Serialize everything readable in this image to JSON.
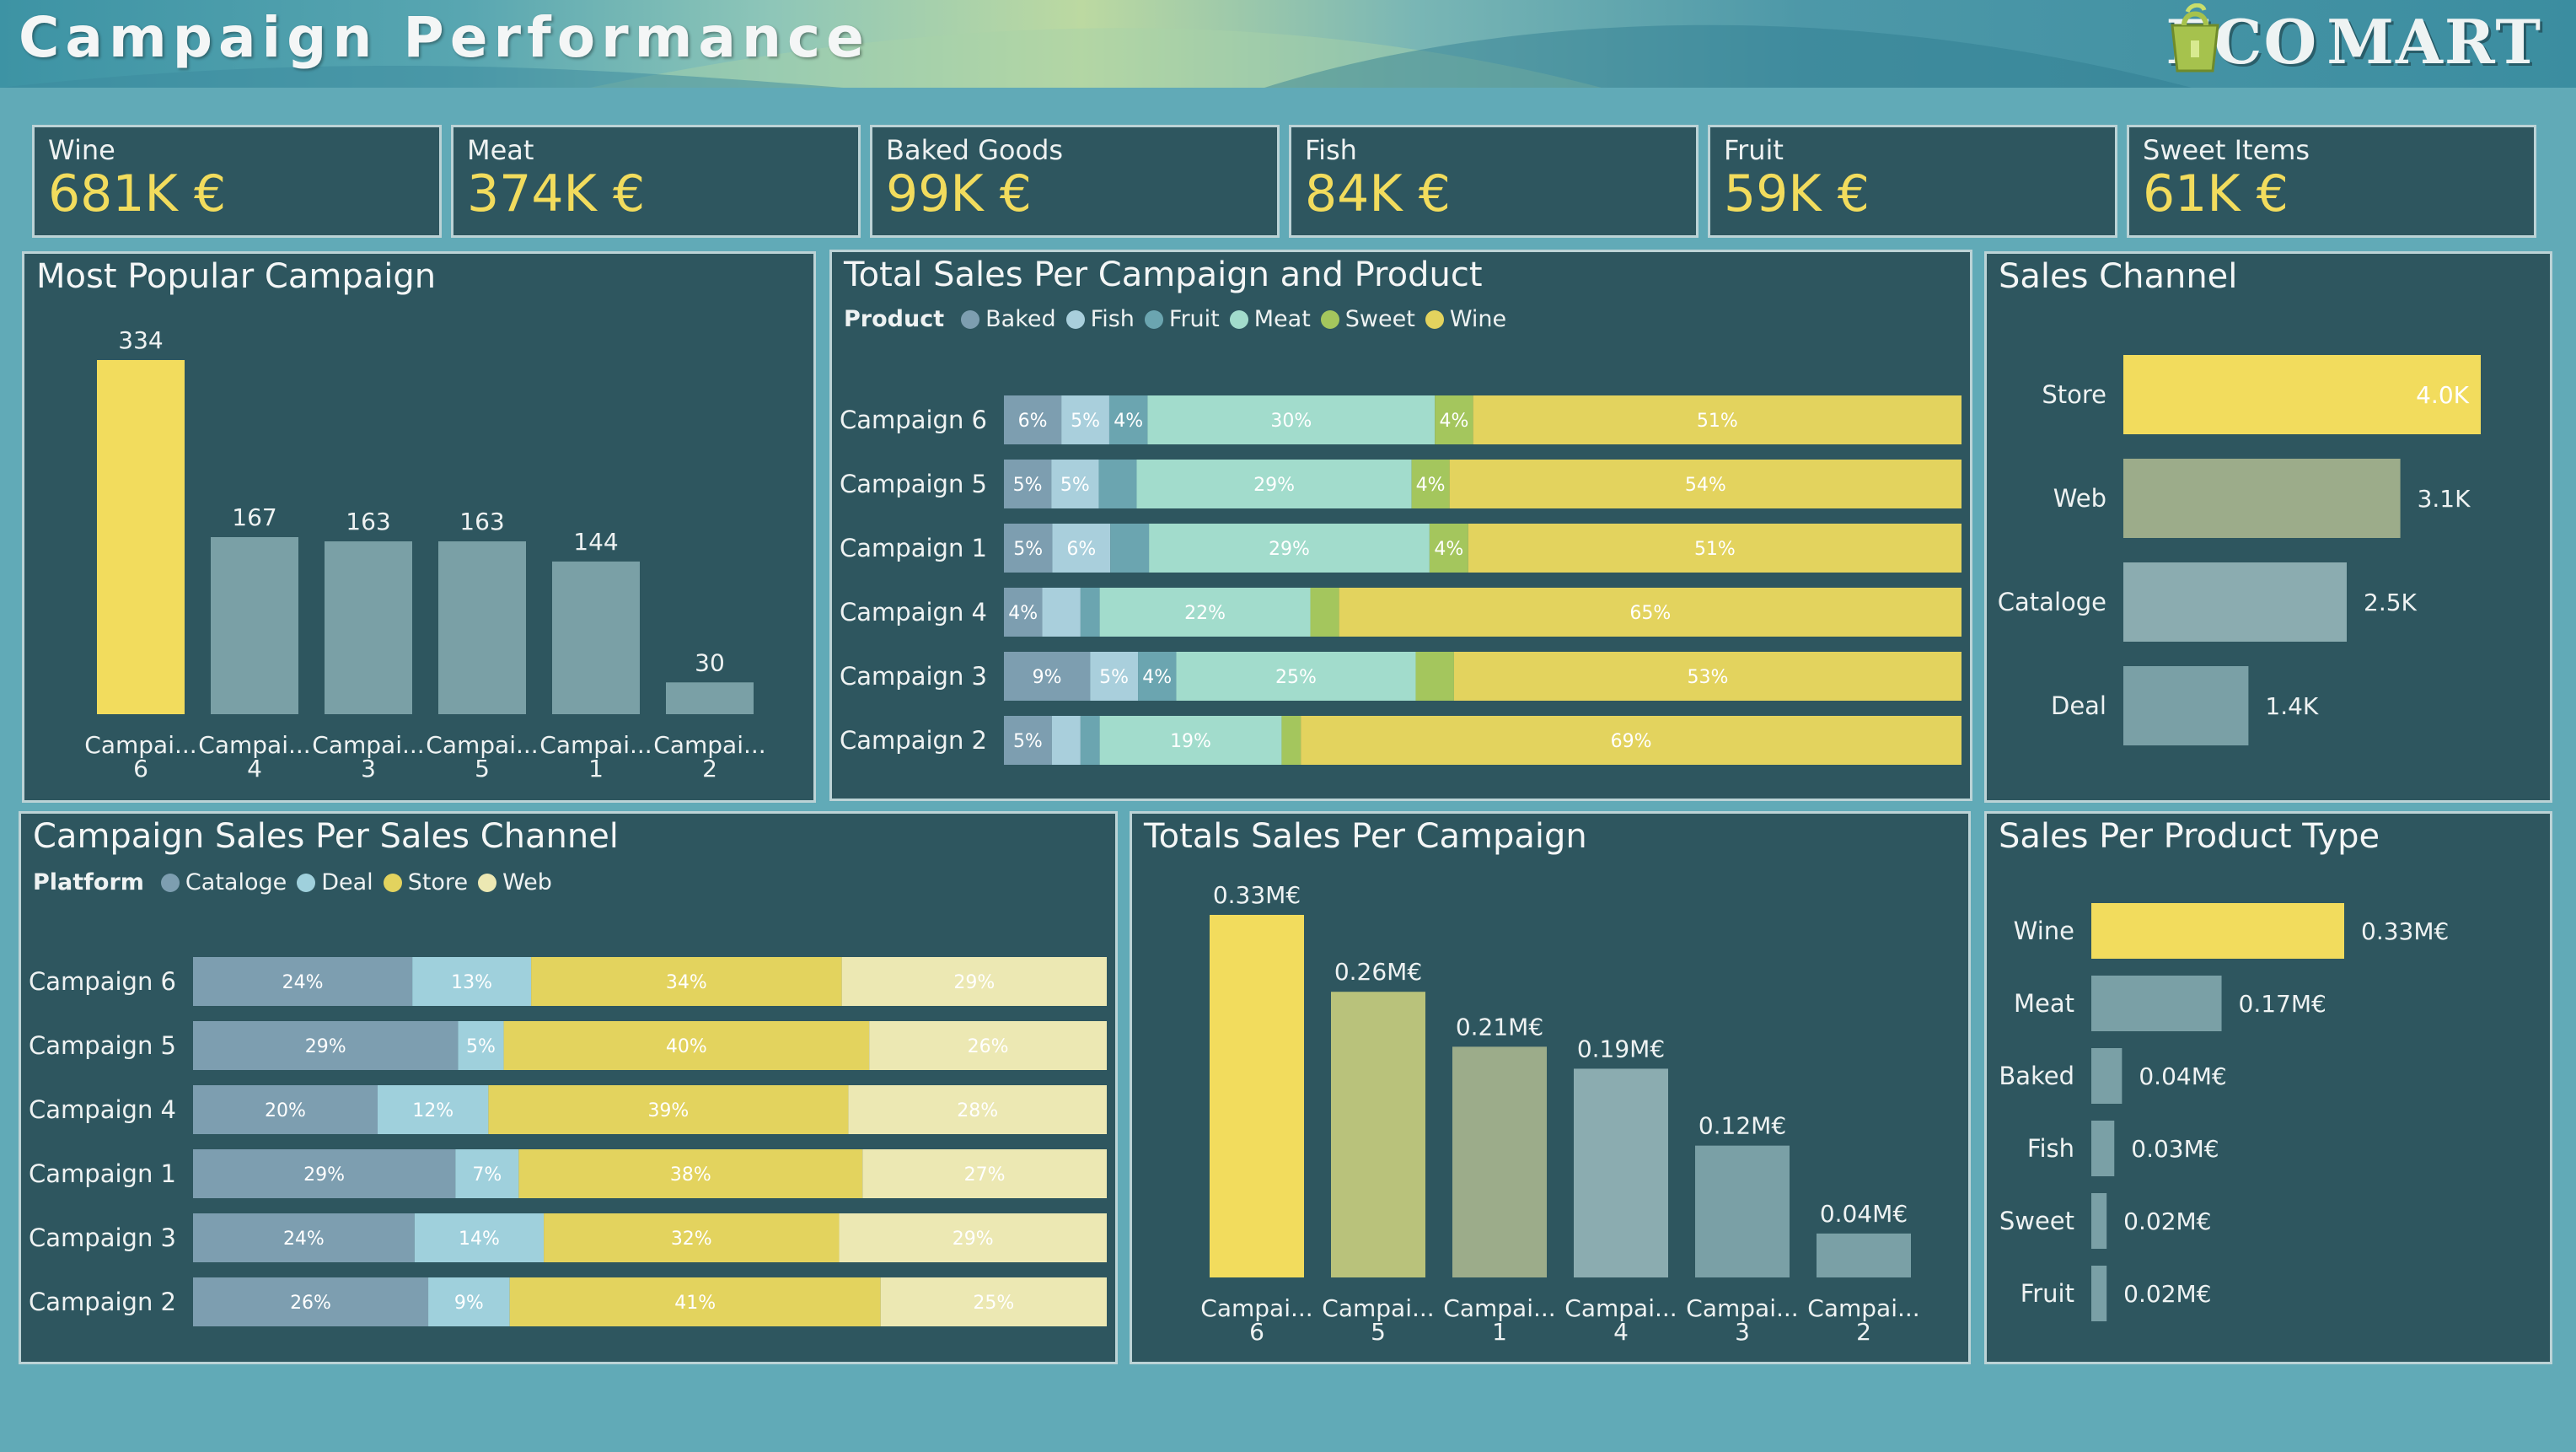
{
  "header": {
    "title": "Campaign Performance",
    "logo_left": "ECO",
    "logo_right": "MART"
  },
  "colors": {
    "yellow": "#f2dc5d",
    "olive": "#b9c27b",
    "sage": "#9cac8a",
    "steel": "#8bacb0",
    "grey_teal": "#7aa0a6",
    "baked": "#7d9eb0",
    "fish": "#a9cfdc",
    "fruit": "#6ba5b0",
    "meat": "#a2dccc",
    "sweet": "#a4c65d",
    "wine": "#e3d35e",
    "cataloge": "#7d9eb0",
    "deal": "#9fd0dc",
    "store": "#e3d35e",
    "web": "#ece8b3"
  },
  "kpis": [
    {
      "label": "Wine",
      "value": "681K €"
    },
    {
      "label": "Meat",
      "value": "374K €"
    },
    {
      "label": "Baked Goods",
      "value": "99K €"
    },
    {
      "label": "Fish",
      "value": "84K €"
    },
    {
      "label": "Fruit",
      "value": "59K €"
    },
    {
      "label": "Sweet Items",
      "value": "61K €"
    }
  ],
  "panels": {
    "popular": {
      "title": "Most Popular Campaign"
    },
    "product": {
      "title": "Total Sales Per Campaign and Product",
      "legend_title": "Product"
    },
    "channel": {
      "title": "Sales Channel"
    },
    "platform": {
      "title": "Campaign Sales Per Sales Channel",
      "legend_title": "Platform"
    },
    "totals": {
      "title": "Totals Sales Per Campaign"
    },
    "ptype": {
      "title": "Sales Per Product Type"
    }
  },
  "chart_data": [
    {
      "id": "popular",
      "type": "bar",
      "title": "Most Popular Campaign",
      "categories": [
        "Campai... 6",
        "Campai... 4",
        "Campai... 3",
        "Campai... 5",
        "Campai... 1",
        "Campai... 2"
      ],
      "values": [
        334,
        167,
        163,
        163,
        144,
        30
      ],
      "value_labels": [
        "334",
        "167",
        "163",
        "163",
        "144",
        "30"
      ],
      "highlight_index": 0
    },
    {
      "id": "product",
      "type": "bar",
      "orientation": "horizontal-stacked-100",
      "title": "Total Sales Per Campaign and Product",
      "legend": [
        "Baked",
        "Fish",
        "Fruit",
        "Meat",
        "Sweet",
        "Wine"
      ],
      "categories": [
        "Campaign 6",
        "Campaign 5",
        "Campaign 1",
        "Campaign 4",
        "Campaign 3",
        "Campaign 2"
      ],
      "series": [
        {
          "name": "Baked",
          "values": [
            6,
            5,
            5,
            4,
            9,
            5
          ],
          "labels": [
            "6%",
            "5%",
            "5%",
            "4%",
            "9%",
            "5%"
          ]
        },
        {
          "name": "Fish",
          "values": [
            5,
            5,
            6,
            4,
            5,
            3
          ],
          "labels": [
            "5%",
            "5%",
            "6%",
            "",
            "5%",
            ""
          ]
        },
        {
          "name": "Fruit",
          "values": [
            4,
            4,
            4,
            2,
            4,
            2
          ],
          "labels": [
            "4%",
            "",
            "",
            "",
            "4%",
            ""
          ]
        },
        {
          "name": "Meat",
          "values": [
            30,
            29,
            29,
            22,
            25,
            19
          ],
          "labels": [
            "30%",
            "29%",
            "29%",
            "22%",
            "25%",
            "19%"
          ]
        },
        {
          "name": "Sweet",
          "values": [
            4,
            4,
            4,
            3,
            4,
            2
          ],
          "labels": [
            "4%",
            "4%",
            "4%",
            "",
            "",
            ""
          ]
        },
        {
          "name": "Wine",
          "values": [
            51,
            54,
            51,
            65,
            53,
            69
          ],
          "labels": [
            "51%",
            "54%",
            "51%",
            "65%",
            "53%",
            "69%"
          ]
        }
      ]
    },
    {
      "id": "channel",
      "type": "bar",
      "orientation": "horizontal",
      "title": "Sales Channel",
      "categories": [
        "Store",
        "Web",
        "Cataloge",
        "Deal"
      ],
      "values": [
        4.0,
        3.1,
        2.5,
        1.4
      ],
      "value_labels": [
        "4.0K",
        "3.1K",
        "2.5K",
        "1.4K"
      ]
    },
    {
      "id": "platform",
      "type": "bar",
      "orientation": "horizontal-stacked-100",
      "title": "Campaign Sales Per Sales Channel",
      "legend": [
        "Cataloge",
        "Deal",
        "Store",
        "Web"
      ],
      "categories": [
        "Campaign 6",
        "Campaign 5",
        "Campaign 4",
        "Campaign 1",
        "Campaign 3",
        "Campaign 2"
      ],
      "series": [
        {
          "name": "Cataloge",
          "values": [
            24,
            29,
            20,
            29,
            24,
            26
          ],
          "labels": [
            "24%",
            "29%",
            "20%",
            "29%",
            "24%",
            "26%"
          ]
        },
        {
          "name": "Deal",
          "values": [
            13,
            5,
            12,
            7,
            14,
            9
          ],
          "labels": [
            "13%",
            "5%",
            "12%",
            "7%",
            "14%",
            "9%"
          ]
        },
        {
          "name": "Store",
          "values": [
            34,
            40,
            39,
            38,
            32,
            41
          ],
          "labels": [
            "34%",
            "40%",
            "39%",
            "38%",
            "32%",
            "41%"
          ]
        },
        {
          "name": "Web",
          "values": [
            29,
            26,
            28,
            27,
            29,
            25
          ],
          "labels": [
            "29%",
            "26%",
            "28%",
            "27%",
            "29%",
            "25%"
          ]
        }
      ]
    },
    {
      "id": "totals",
      "type": "bar",
      "title": "Totals Sales Per Campaign",
      "categories": [
        "Campai... 6",
        "Campai... 5",
        "Campai... 1",
        "Campai... 4",
        "Campai... 3",
        "Campai... 2"
      ],
      "values": [
        0.33,
        0.26,
        0.21,
        0.19,
        0.12,
        0.04
      ],
      "value_labels": [
        "0.33M€",
        "0.26M€",
        "0.21M€",
        "0.19M€",
        "0.12M€",
        "0.04M€"
      ]
    },
    {
      "id": "ptype",
      "type": "bar",
      "orientation": "horizontal",
      "title": "Sales Per Product Type",
      "categories": [
        "Wine",
        "Meat",
        "Baked",
        "Fish",
        "Sweet",
        "Fruit"
      ],
      "values": [
        0.33,
        0.17,
        0.04,
        0.03,
        0.02,
        0.02
      ],
      "value_labels": [
        "0.33M€",
        "0.17M€",
        "0.04M€",
        "0.03M€",
        "0.02M€",
        "0.02M€"
      ]
    }
  ]
}
